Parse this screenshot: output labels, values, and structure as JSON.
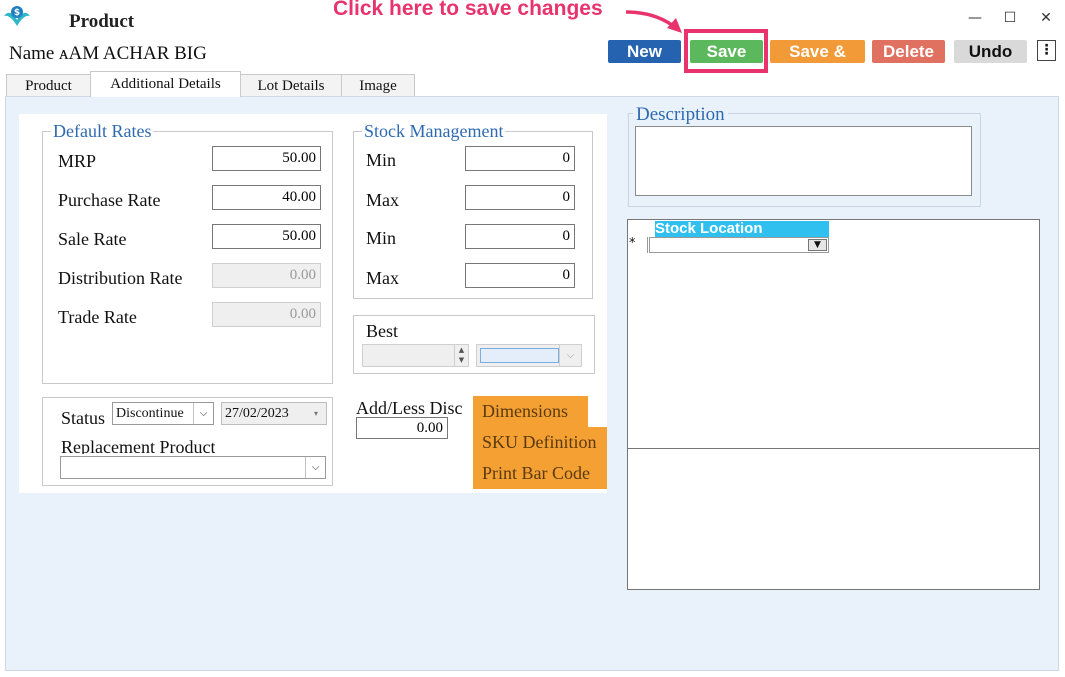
{
  "window": {
    "title": "Product",
    "minimize_glyph": "—",
    "maximize_glyph": "☐",
    "close_glyph": "✕"
  },
  "annotation": {
    "text": "Click here to save changes",
    "color": "#e8336d"
  },
  "product": {
    "name_label": "Name",
    "name_value": "ᴀAM ACHAR BIG"
  },
  "actions": {
    "new": "New",
    "save": "Save",
    "save_and": "Save &",
    "delete": "Delete",
    "undo": "Undo",
    "more": "⋮",
    "colors": {
      "new": "#2563b0",
      "save": "#5cb85c",
      "save_and": "#f39a38",
      "delete": "#e0705f",
      "undo": "#d9d9d9"
    }
  },
  "tabs": [
    "Product",
    "Additional Details",
    "Lot Details",
    "Image"
  ],
  "active_tab": "Additional Details",
  "default_rates": {
    "title": "Default Rates",
    "mrp_label": "MRP",
    "mrp_value": "50.00",
    "purchase_label": "Purchase Rate",
    "purchase_value": "40.00",
    "sale_label": "Sale Rate",
    "sale_value": "50.00",
    "distribution_label": "Distribution Rate",
    "distribution_value": "0.00",
    "trade_label": "Trade Rate",
    "trade_value": "0.00"
  },
  "stock_management": {
    "title": "Stock Management",
    "min1_label": "Min",
    "min1_value": "0",
    "max1_label": "Max",
    "max1_value": "0",
    "min2_label": "Min",
    "min2_value": "0",
    "max2_label": "Max",
    "max2_value": "0"
  },
  "best": {
    "label": "Best"
  },
  "status": {
    "label": "Status",
    "value": "Discontinue",
    "date": "27/02/2023",
    "replacement_label": "Replacement Product",
    "replacement_value": ""
  },
  "discount": {
    "label": "Add/Less Disc",
    "value": "0.00"
  },
  "side_buttons": {
    "dimensions": "Dimensions",
    "sku": "SKU Definition",
    "barcode": "Print Bar Code"
  },
  "description": {
    "title": "Description",
    "value": ""
  },
  "stock_location": {
    "column": "Stock Location",
    "new_row_marker": "*"
  }
}
